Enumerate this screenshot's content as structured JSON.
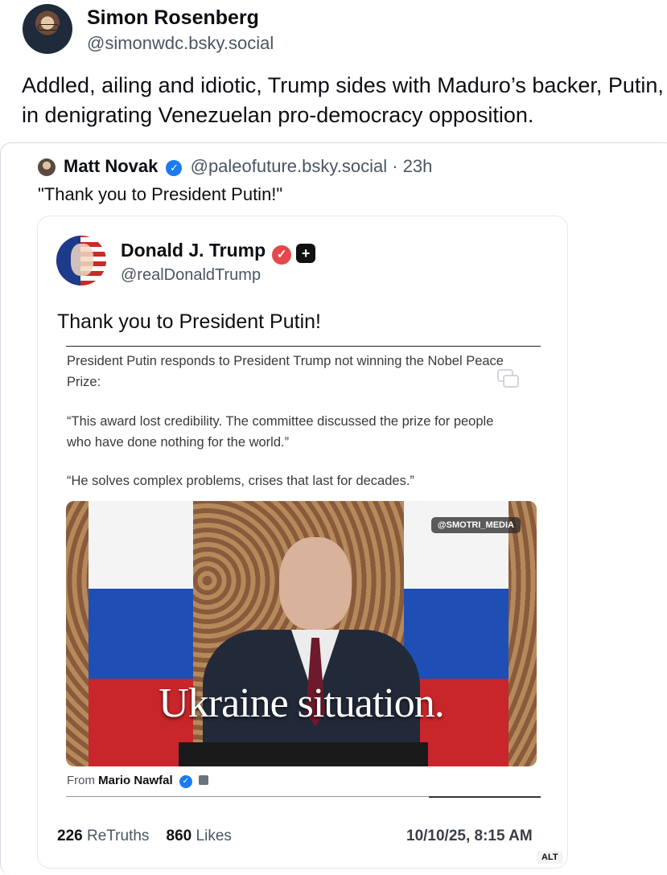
{
  "post": {
    "author_name": "Simon Rosenberg",
    "author_handle": "@simonwdc.bsky.social",
    "text": "Addled, ailing and idiotic, Trump sides with Maduro’s backer, Putin, in denigrating Venezuelan pro-democracy opposition."
  },
  "quote": {
    "author_name": "Matt Novak",
    "author_handle": "@paleofuture.bsky.social",
    "time_sep": "·",
    "time": "23h",
    "text": "\"Thank you to President Putin!\""
  },
  "truth": {
    "author_name": "Donald J. Trump",
    "author_handle": "@realDonaldTrump",
    "text": "Thank you to President Putin!",
    "embed_paragraph_1": "President Putin responds to President Trump not winning the Nobel Peace Prize:",
    "embed_paragraph_2": "“This award lost credibility. The committee discussed the prize for people who have done nothing for the world.”",
    "embed_paragraph_3": "“He solves complex problems, crises that last for decades.”",
    "video_watermark": "@SMOTRI_MEDIA",
    "video_caption": "Ukraine situation.",
    "from_label": "From",
    "from_name": "Mario Nawfal",
    "retruths_count": "226",
    "retruths_label": "ReTruths",
    "likes_count": "860",
    "likes_label": "Likes",
    "timestamp": "10/10/25, 8:15 AM",
    "alt_badge": "ALT"
  },
  "colors": {
    "verified_blue": "#1d7bf0",
    "truth_verified_red": "#e5484d",
    "flag_white": "#f4f4f4",
    "flag_blue": "#1f4fb5",
    "flag_red": "#c8262b"
  },
  "icons": [
    "verified-badge-icon",
    "truth-verified-icon",
    "truth-plus-icon",
    "copy-icon"
  ]
}
